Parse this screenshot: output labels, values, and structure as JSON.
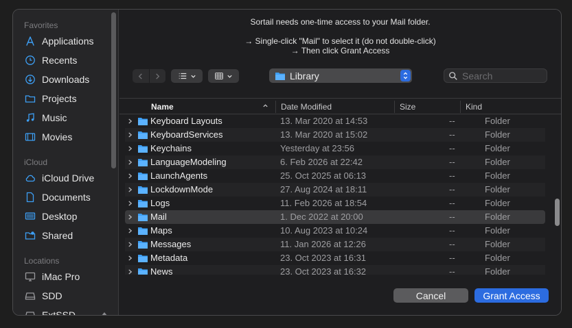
{
  "message": {
    "line1": "Sortail needs one-time access to your Mail folder.",
    "line2": "→ Single-click \"Mail\" to select it (do not double-click)",
    "line3": "→ Then click Grant Access"
  },
  "sidebar": {
    "favorites_label": "Favorites",
    "favorites": [
      {
        "label": "Applications",
        "icon": "applications-icon"
      },
      {
        "label": "Recents",
        "icon": "clock-icon"
      },
      {
        "label": "Downloads",
        "icon": "download-icon"
      },
      {
        "label": "Projects",
        "icon": "folder-icon"
      },
      {
        "label": "Music",
        "icon": "music-icon"
      },
      {
        "label": "Movies",
        "icon": "film-icon"
      }
    ],
    "icloud_label": "iCloud",
    "icloud": [
      {
        "label": "iCloud Drive",
        "icon": "cloud-icon"
      },
      {
        "label": "Documents",
        "icon": "document-icon"
      },
      {
        "label": "Desktop",
        "icon": "desktop-icon"
      },
      {
        "label": "Shared",
        "icon": "shared-folder-icon"
      }
    ],
    "locations_label": "Locations",
    "locations": [
      {
        "label": "iMac Pro",
        "icon": "computer-icon"
      },
      {
        "label": "SDD",
        "icon": "drive-icon"
      },
      {
        "label": "ExtSSD",
        "icon": "drive-icon"
      }
    ]
  },
  "toolbar": {
    "location": "Library",
    "search_placeholder": "Search"
  },
  "columns": {
    "name": "Name",
    "date": "Date Modified",
    "size": "Size",
    "kind": "Kind"
  },
  "rows": [
    {
      "name": "Keyboard Layouts",
      "date": "13. Mar 2020 at 14:53",
      "size": "--",
      "kind": "Folder"
    },
    {
      "name": "KeyboardServices",
      "date": "13. Mar 2020 at 15:02",
      "size": "--",
      "kind": "Folder"
    },
    {
      "name": "Keychains",
      "date": "Yesterday at 23:56",
      "size": "--",
      "kind": "Folder"
    },
    {
      "name": "LanguageModeling",
      "date": "6. Feb 2026 at 22:42",
      "size": "--",
      "kind": "Folder"
    },
    {
      "name": "LaunchAgents",
      "date": "25. Oct 2025 at 06:13",
      "size": "--",
      "kind": "Folder"
    },
    {
      "name": "LockdownMode",
      "date": "27. Aug 2024 at 18:11",
      "size": "--",
      "kind": "Folder"
    },
    {
      "name": "Logs",
      "date": "11. Feb 2026 at 18:54",
      "size": "--",
      "kind": "Folder"
    },
    {
      "name": "Mail",
      "date": "1. Dec 2022 at 20:00",
      "size": "--",
      "kind": "Folder"
    },
    {
      "name": "Maps",
      "date": "10. Aug 2023 at 10:24",
      "size": "--",
      "kind": "Folder"
    },
    {
      "name": "Messages",
      "date": "11. Jan 2026 at 12:26",
      "size": "--",
      "kind": "Folder"
    },
    {
      "name": "Metadata",
      "date": "23. Oct 2023 at 16:31",
      "size": "--",
      "kind": "Folder"
    },
    {
      "name": "News",
      "date": "23. Oct 2023 at 16:32",
      "size": "--",
      "kind": "Folder"
    }
  ],
  "selected_row": "Mail",
  "buttons": {
    "cancel": "Cancel",
    "grant": "Grant Access"
  },
  "colors": {
    "accent": "#2c6ce0",
    "folder": "#3d9ff5"
  }
}
